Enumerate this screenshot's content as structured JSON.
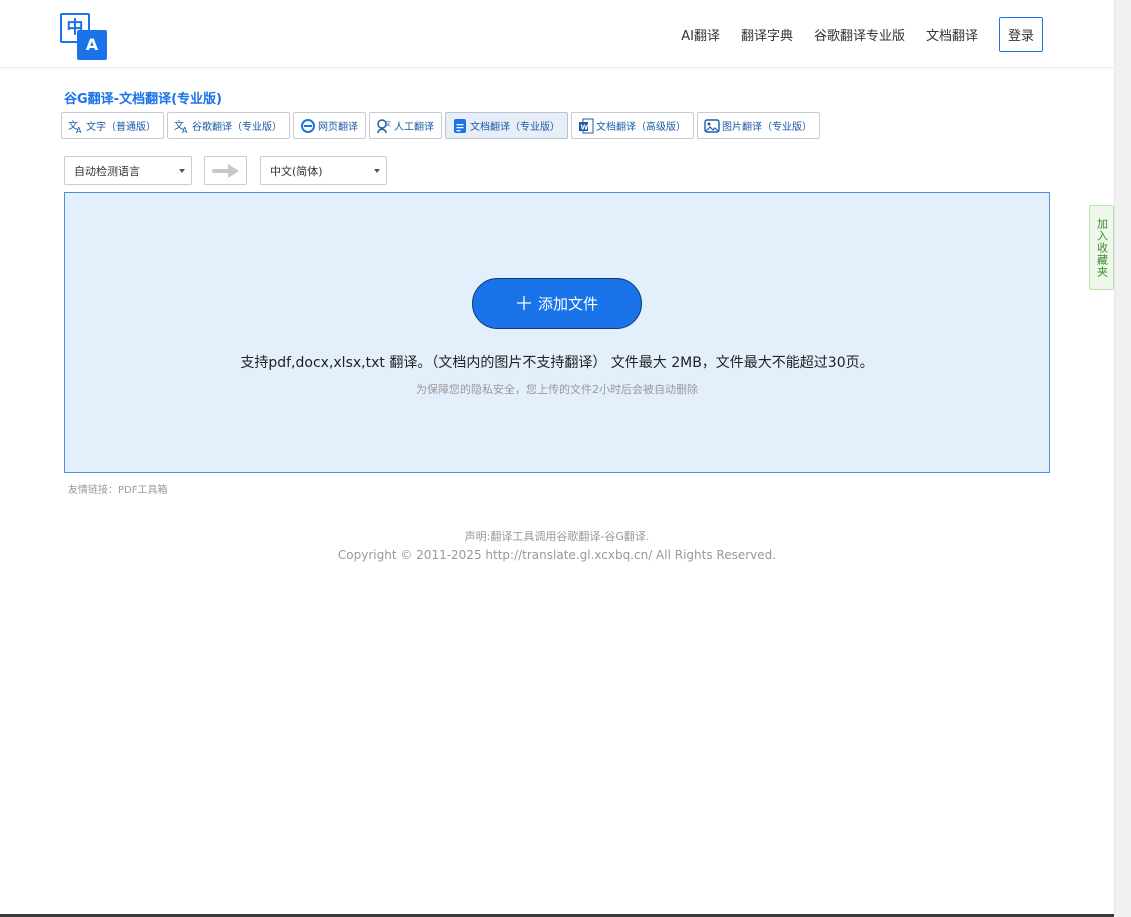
{
  "header": {
    "logo": {
      "top_glyph": "中",
      "bottom_glyph": "A",
      "icon": "translate-logo-icon"
    },
    "nav": [
      {
        "label": "AI翻译"
      },
      {
        "label": "翻译字典"
      },
      {
        "label": "谷歌翻译专业版"
      },
      {
        "label": "文档翻译"
      }
    ],
    "login_label": "登录"
  },
  "page_title": "谷G翻译-文档翻译(专业版)",
  "tabs": [
    {
      "label": "文字（普通版）",
      "icon": "text-translate-icon",
      "active": false
    },
    {
      "label": "谷歌翻译（专业版）",
      "icon": "text-translate-icon",
      "active": false
    },
    {
      "label": "网页翻译",
      "icon": "browser-e-icon",
      "active": false
    },
    {
      "label": "人工翻译",
      "icon": "human-translate-icon",
      "active": false
    },
    {
      "label": "文档翻译（专业版）",
      "icon": "document-icon",
      "active": true
    },
    {
      "label": "文档翻译（高级版）",
      "icon": "word-document-icon",
      "active": false
    },
    {
      "label": "图片翻译（专业版）",
      "icon": "image-icon",
      "active": false
    }
  ],
  "language": {
    "source": "自动检测语言",
    "target": "中文(简体)",
    "swap_icon": "arrow-right-icon"
  },
  "upload": {
    "button_label": "添加文件",
    "button_icon": "plus-icon",
    "support_text": "支持pdf,docx,xlsx,txt 翻译。（文档内的图片不支持翻译） 文件最大 2MB，文件最大不能超过30页。",
    "privacy_text": "为保障您的隐私安全，您上传的文件2小时后会被自动删除"
  },
  "friend_links": "友情链接：PDF工具箱",
  "footer": {
    "declaration": "声明:翻译工具调用谷歌翻译-谷G翻译.",
    "copyright": "Copyright © 2011-2025 http://translate.gl.xcxbq.cn/ All Rights Reserved."
  },
  "favorite_label": "加入收藏夹",
  "colors": {
    "accent": "#1a73e8",
    "upload_bg": "#e4effc",
    "favorite_bg": "#eef8ea"
  }
}
